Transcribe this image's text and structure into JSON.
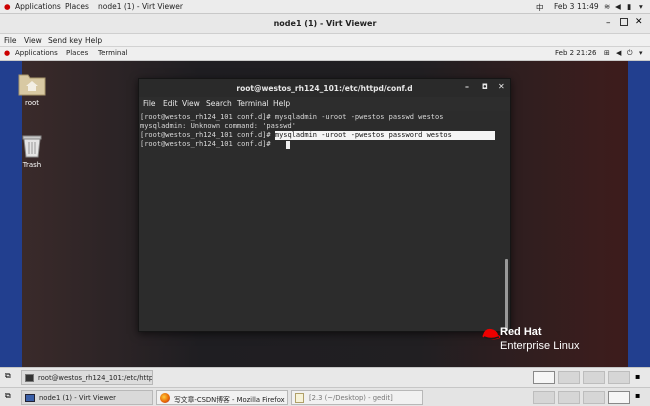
{
  "host_topbar": {
    "applications": "Applications",
    "places": "Places",
    "window_title": "node1 (1) - Virt Viewer",
    "input_method": "中",
    "date": "Feb 3",
    "time": "11:49"
  },
  "virt_viewer": {
    "title": "node1 (1) - Virt Viewer",
    "menu": [
      "File",
      "View",
      "Send key",
      "Help"
    ]
  },
  "guest_topbar": {
    "applications": "Applications",
    "places": "Places",
    "terminal": "Terminal",
    "datetime": "Feb 2  21:26"
  },
  "desktop": {
    "icons": [
      {
        "label": "root",
        "icon": "home-folder-icon"
      },
      {
        "label": "Trash",
        "icon": "trash-icon"
      }
    ]
  },
  "terminal": {
    "title": "root@westos_rh124_101:/etc/httpd/conf.d",
    "menu": [
      "File",
      "Edit",
      "View",
      "Search",
      "Terminal",
      "Help"
    ],
    "lines": [
      {
        "prompt": "[root@westos_rh124_101 conf.d]# ",
        "text": "mysqladmin -uroot -pwestos passwd westos",
        "highlight": false
      },
      {
        "prompt": "",
        "text": "mysqladmin: Unknown command: 'passwd'",
        "highlight": false
      },
      {
        "prompt": "[root@westos_rh124_101 conf.d]# ",
        "text": "mysqladmin -uroot -pwestos password westos",
        "highlight": true
      },
      {
        "prompt": "[root@westos_rh124_101 conf.d]# ",
        "text": "",
        "highlight": false
      }
    ]
  },
  "branding": {
    "line1": "Red Hat",
    "line2": "Enterprise Linux",
    "color": "#ee0000"
  },
  "guest_taskbar": {
    "task": "root@westos_rh124_101:/etc/http..."
  },
  "host_taskbar": {
    "tasks": [
      {
        "label": "node1 (1) - Virt Viewer",
        "icon": "monitor-icon"
      },
      {
        "label": "写文章-CSDN博客 - Mozilla Firefox",
        "icon": "firefox-icon"
      },
      {
        "label": "[2.3 (~/Desktop) - gedit]",
        "icon": "gedit-icon"
      }
    ]
  }
}
